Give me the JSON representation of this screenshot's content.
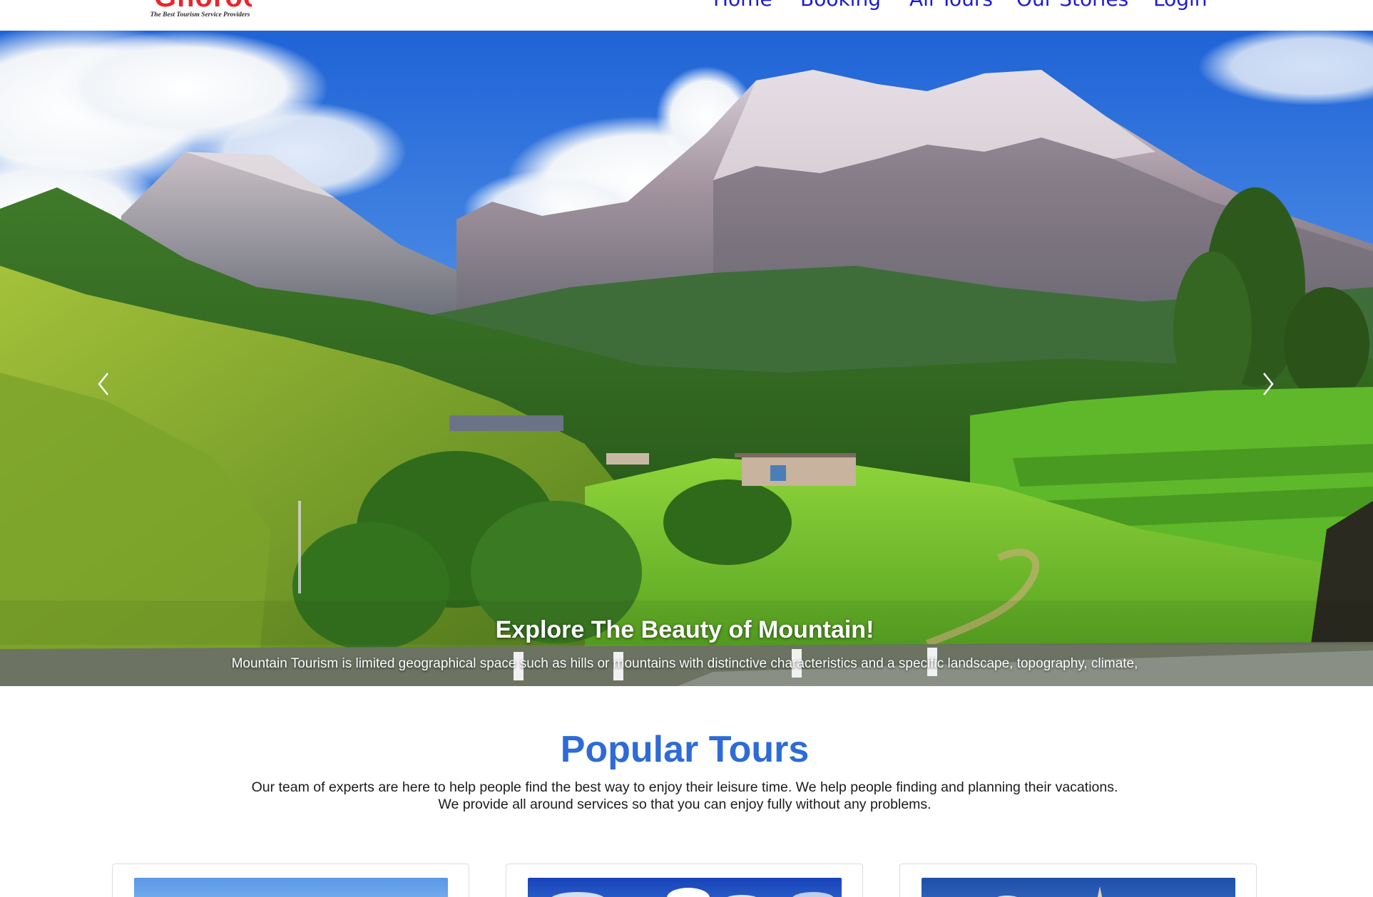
{
  "brand": {
    "name": "Ghoroo",
    "tagline": "The Best Tourism Service Providers",
    "logo_color": "#e8262b"
  },
  "nav": {
    "items": [
      {
        "label": "Home"
      },
      {
        "label": "Booking"
      },
      {
        "label": "All Tours"
      },
      {
        "label": "Our Stories"
      },
      {
        "label": "Login"
      }
    ],
    "link_color": "#1a1ad6"
  },
  "hero": {
    "image_subject": "mountain-landscape",
    "title": "Explore The Beauty of Mountain!",
    "text": "Mountain Tourism is limited geographical space such as hills or mountains with distinctive characteristics and a specific landscape, topography, climate,",
    "slide_count": 3,
    "active_slide": 3,
    "prev_icon": "chevron-left-icon",
    "next_icon": "chevron-right-icon"
  },
  "popular_tours": {
    "title": "Popular Tours",
    "desc_line1": "Our team of experts are here to help people find the best way to enjoy their leisure time. We help people finding and planning their vacations.",
    "desc_line2": "We provide all around services so that you can enjoy fully without any problems.",
    "title_color": "#2e6bd6",
    "cards": [
      {
        "image_subject": "sky-landscape"
      },
      {
        "image_subject": "snowy-mountain"
      },
      {
        "image_subject": "temple-spire"
      }
    ]
  }
}
